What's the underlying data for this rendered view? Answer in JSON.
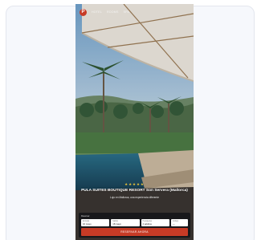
{
  "brand": {
    "logo_letter": "P",
    "accent": "#c73b26"
  },
  "nav": {
    "items": [
      "HOTEL",
      "ROOMS",
      "SPA"
    ]
  },
  "hero": {
    "stars": "★★★★★",
    "title": "PULA SUITES BOUTIQUE RESORT Son Servera (Mallorca)",
    "subtitle": "Lujo en Mallorca, una experiencia diferente"
  },
  "booking": {
    "label": "Reservar",
    "fields": [
      {
        "label": "Entrada",
        "value": "16 mayo"
      },
      {
        "label": "Salida",
        "value": "18 mayo"
      },
      {
        "label": "Huéspedes",
        "value": "2 adultos"
      },
      {
        "label": "Código",
        "value": "—"
      }
    ],
    "cta": "RESERVAR AHORA"
  }
}
